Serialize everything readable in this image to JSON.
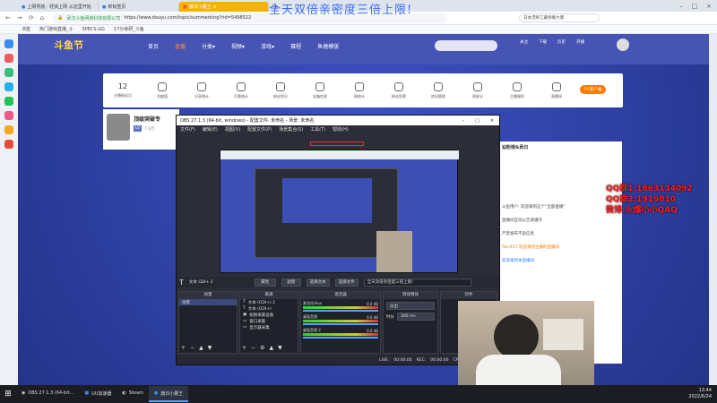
{
  "overlay_banner": "全天双倍亲密度三倍上限!",
  "browser": {
    "tabs": [
      {
        "label": "上网导航 · 轻快上网 从这里开始",
        "type": "plain"
      },
      {
        "label": "新标签页",
        "type": "plain"
      },
      {
        "label": "旗日小蘑王",
        "type": "yellow"
      }
    ],
    "tab_add": "+",
    "site_name": "武汉斗鱼网络科技有限公司",
    "url": "https://www.douyu.com/topic/summerking?rid=5498522",
    "search_hint": "日本漂移江藏保撤大爆",
    "bookmarks": [
      "书签",
      "热门游戏直播_斗",
      "SPECS.GG",
      "17分考研_斗鱼"
    ]
  },
  "douyu": {
    "logo": "斗鱼节",
    "nav": [
      "首页",
      "直播",
      "分类▾",
      "视频▾",
      "游戏▾",
      "赛程",
      "鱼塘模版"
    ],
    "user_stats": [
      "关注",
      "下载",
      "历史",
      "开播"
    ],
    "tools": [
      {
        "num": "12",
        "label": "主播粉丝月"
      },
      {
        "label": "贡献值"
      },
      {
        "label": "分享统计"
      },
      {
        "label": "月票统计"
      },
      {
        "label": "粉丝积分"
      },
      {
        "label": "宝箱信息"
      },
      {
        "label": "周统计"
      },
      {
        "label": "粉丝投票"
      },
      {
        "label": "房间管理"
      },
      {
        "label": "周星分"
      },
      {
        "label": "主播福利"
      },
      {
        "label": "直播间"
      },
      {
        "label": "热门"
      }
    ],
    "pc_button": "PC客户端",
    "streamer_name": "顶级突破专",
    "streamer_tags": [
      "LV",
      "7.6万"
    ],
    "chat": {
      "header": "钻粉榜&贡日",
      "lines": [
        "斗鱼用户: 欢迎来到这个“全部直播”",
        "直播间互动公告请遵守",
        "严禁发布不良信息",
        "Pan#27 欢迎来到主播的直播间",
        "欢迎来到本直播间"
      ]
    }
  },
  "qq_overlay": [
    "QQ群1:1863134092",
    "QQ群2:1919810",
    "微博:火爆小小QAQ"
  ],
  "obs": {
    "title": "OBS 27.1.3 (64-bit, windows) - 配置文件: 未命名 - 场景: 未命名",
    "menu": [
      "文件(F)",
      "编辑(E)",
      "视图(V)",
      "配置文件(P)",
      "场景集合(S)",
      "工具(T)",
      "帮助(H)"
    ],
    "src_toolbar": {
      "text_label": "文本 GDI+ 2",
      "props": "属性",
      "filters": "滤镜",
      "pick_text": "选择文本",
      "pick_file": "选择文件",
      "scroll": "全天双倍亲密度三倍上限!"
    },
    "docks": {
      "scenes": "场景",
      "sources": "来源",
      "mixer": "混音器",
      "transitions": "转场特效",
      "controls": "控件"
    },
    "scenes": [
      "场景"
    ],
    "sources": [
      "文本 (GDI+) 2",
      "文本 (GDI+)",
      "视频采集设备",
      "窗口采集",
      "显示器采集"
    ],
    "mixer": [
      {
        "name": "麦克风/Aux",
        "db": "0.0 dB"
      },
      {
        "name": "桌面音频",
        "db": "0.0 dB"
      },
      {
        "name": "桌面音频 2",
        "db": "0.0 dB"
      }
    ],
    "transition": {
      "type": "淡出",
      "duration_label": "时长",
      "duration": "300 ms"
    },
    "controls": [
      "开始推流",
      "开始录制",
      "启动虚拟摄像机",
      "工作室模式",
      "设置",
      "退出"
    ],
    "status": {
      "live_label": "LIVE:",
      "live_time": "00:00:00",
      "rec_label": "REC:",
      "rec_time": "00:00:00",
      "cpu": "CPU: 0.6%, 30.00 fps"
    }
  },
  "taskbar": {
    "items": [
      {
        "label": "OBS 27.1.3 (64-bit...",
        "active": false
      },
      {
        "label": "UU加速器",
        "active": false
      },
      {
        "label": "Steam",
        "active": false
      },
      {
        "label": "旗日小蘑王",
        "active": true
      }
    ],
    "time": "13:44",
    "date": "2022/6/24"
  },
  "colors": {
    "douyu_orange": "#ff7a00",
    "obs_bg": "#2b2e38",
    "accent_blue": "#3a6df0",
    "qq_red": "#ff1a1a"
  }
}
